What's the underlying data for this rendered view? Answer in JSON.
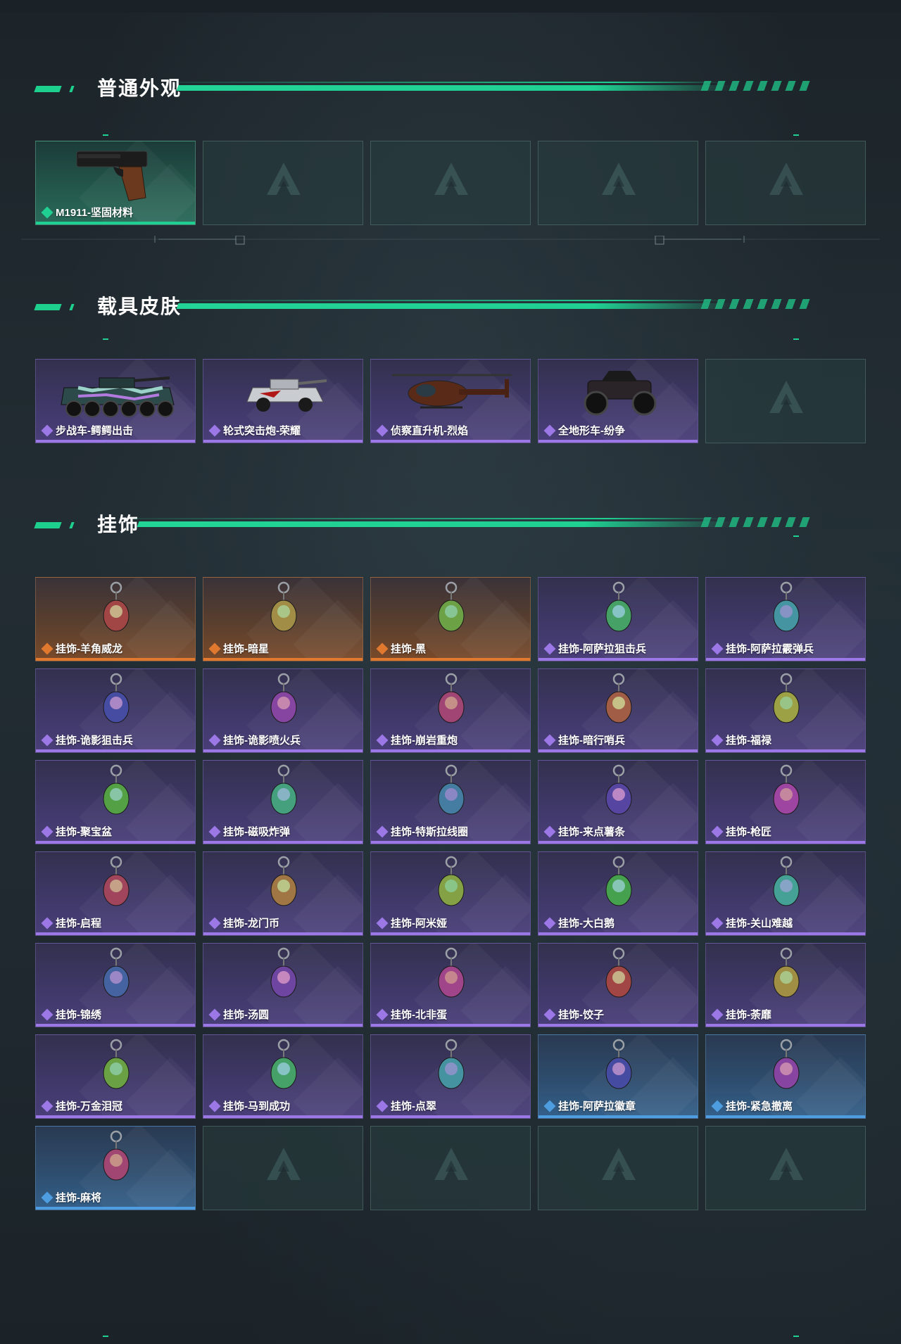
{
  "sections": [
    {
      "title": "普通外观",
      "items": [
        {
          "label": "M1911-坚固材料",
          "rarity": "green",
          "icon": "pistol-icon"
        },
        {
          "empty": true
        },
        {
          "empty": true
        },
        {
          "empty": true
        },
        {
          "empty": true
        }
      ]
    },
    {
      "title": "载具皮肤",
      "items": [
        {
          "label": "步战车-鳄鳄出击",
          "rarity": "purple",
          "icon": "ifv-icon"
        },
        {
          "label": "轮式突击炮-荣耀",
          "rarity": "purple",
          "icon": "armored-car-icon"
        },
        {
          "label": "侦察直升机-烈焰",
          "rarity": "purple",
          "icon": "helicopter-icon"
        },
        {
          "label": "全地形车-纷争",
          "rarity": "purple",
          "icon": "atv-icon"
        },
        {
          "empty": true
        }
      ]
    },
    {
      "title": "挂饰",
      "items": [
        {
          "label": "挂饰-羊角威龙",
          "rarity": "orange",
          "icon": "charm-icon"
        },
        {
          "label": "挂饰-暗星",
          "rarity": "orange",
          "icon": "charm-icon"
        },
        {
          "label": "挂饰-黑",
          "rarity": "orange",
          "icon": "charm-icon"
        },
        {
          "label": "挂饰-阿萨拉狙击兵",
          "rarity": "purple",
          "icon": "charm-icon"
        },
        {
          "label": "挂饰-阿萨拉霰弹兵",
          "rarity": "purple",
          "icon": "charm-icon"
        },
        {
          "label": "挂饰-诡影狙击兵",
          "rarity": "purple",
          "icon": "charm-icon"
        },
        {
          "label": "挂饰-诡影喷火兵",
          "rarity": "purple",
          "icon": "charm-icon"
        },
        {
          "label": "挂饰-崩岩重炮",
          "rarity": "purple",
          "icon": "charm-icon"
        },
        {
          "label": "挂饰-暗行哨兵",
          "rarity": "purple",
          "icon": "charm-icon"
        },
        {
          "label": "挂饰-福禄",
          "rarity": "purple",
          "icon": "charm-icon"
        },
        {
          "label": "挂饰-聚宝盆",
          "rarity": "purple",
          "icon": "charm-icon"
        },
        {
          "label": "挂饰-磁吸炸弹",
          "rarity": "purple",
          "icon": "charm-icon"
        },
        {
          "label": "挂饰-特斯拉线圈",
          "rarity": "purple",
          "icon": "charm-icon"
        },
        {
          "label": "挂饰-来点薯条",
          "rarity": "purple",
          "icon": "charm-icon"
        },
        {
          "label": "挂饰-枪匠",
          "rarity": "purple",
          "icon": "charm-icon"
        },
        {
          "label": "挂饰-启程",
          "rarity": "purple",
          "icon": "charm-icon"
        },
        {
          "label": "挂饰-龙门币",
          "rarity": "purple",
          "icon": "charm-icon"
        },
        {
          "label": "挂饰-阿米娅",
          "rarity": "purple",
          "icon": "charm-icon"
        },
        {
          "label": "挂饰-大白鹅",
          "rarity": "purple",
          "icon": "charm-icon"
        },
        {
          "label": "挂饰-关山难越",
          "rarity": "purple",
          "icon": "charm-icon"
        },
        {
          "label": "挂饰-锦绣",
          "rarity": "purple",
          "icon": "charm-icon"
        },
        {
          "label": "挂饰-汤圆",
          "rarity": "purple",
          "icon": "charm-icon"
        },
        {
          "label": "挂饰-北非蛋",
          "rarity": "purple",
          "icon": "charm-icon"
        },
        {
          "label": "挂饰-饺子",
          "rarity": "purple",
          "icon": "charm-icon"
        },
        {
          "label": "挂饰-荼靡",
          "rarity": "purple",
          "icon": "charm-icon"
        },
        {
          "label": "挂饰-万金泪冠",
          "rarity": "purple",
          "icon": "charm-icon"
        },
        {
          "label": "挂饰-马到成功",
          "rarity": "purple",
          "icon": "charm-icon"
        },
        {
          "label": "挂饰-点翠",
          "rarity": "purple",
          "icon": "charm-icon"
        },
        {
          "label": "挂饰-阿萨拉徽章",
          "rarity": "blue",
          "icon": "charm-icon"
        },
        {
          "label": "挂饰-紧急撤离",
          "rarity": "blue",
          "icon": "charm-icon"
        },
        {
          "label": "挂饰-麻将",
          "rarity": "blue",
          "icon": "charm-icon"
        },
        {
          "empty": true
        },
        {
          "empty": true
        },
        {
          "empty": true
        },
        {
          "empty": true
        }
      ]
    }
  ],
  "colors": {
    "accent": "#1fd092",
    "rarity_green": "#1fd092",
    "rarity_purple": "#9b78e6",
    "rarity_orange": "#e0782e",
    "rarity_blue": "#4d9de0"
  }
}
